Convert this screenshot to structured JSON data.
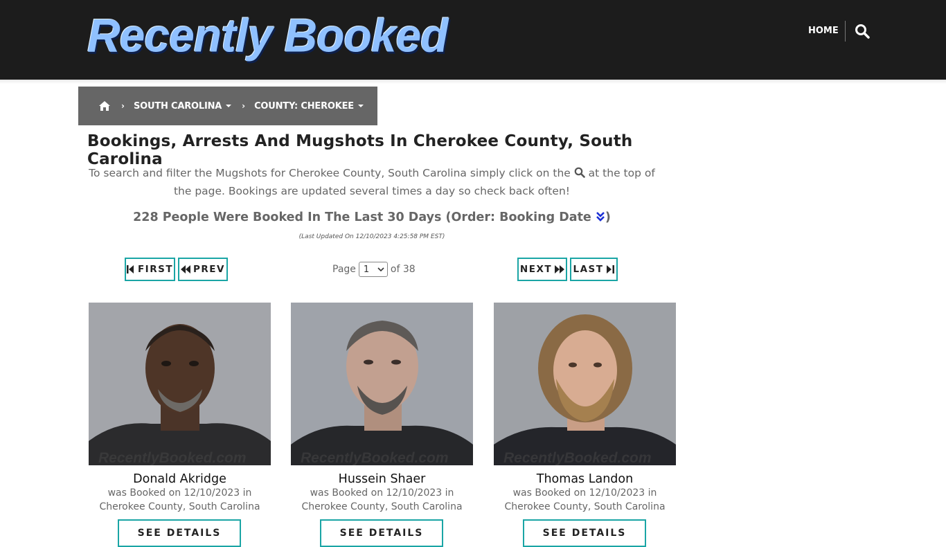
{
  "header": {
    "logo_text": "Recently Booked",
    "nav_home": "HOME",
    "search_icon": "search-icon"
  },
  "breadcrumb": {
    "home_icon": "home-icon",
    "items": [
      {
        "label": "SOUTH CAROLINA"
      },
      {
        "label": "COUNTY: CHEROKEE"
      }
    ]
  },
  "main": {
    "title": "Bookings, Arrests And Mugshots In Cherokee County, South Carolina",
    "intro_before": "To search and filter the Mugshots for Cherokee County, South Carolina simply click on the ",
    "intro_after": " at the top of the page. Bookings are updated several times a day so check back often!",
    "count_text": "228 People Were Booked In The Last 30 Days (Order: Booking Date ",
    "count_close": ")",
    "last_updated": "(Last Updated On 12/10/2023 4:25:58 PM EST)"
  },
  "pager": {
    "first": "FIRST",
    "prev": "PREV",
    "next": "NEXT",
    "last": "LAST",
    "page_label": "Page",
    "current_page": "1",
    "of_label": "of 38"
  },
  "colors": {
    "header_bg": "#1c1c1c",
    "breadcrumb_bg": "#666666",
    "accent_teal": "#1aa5a5",
    "order_icon": "#1a2fd6"
  },
  "cards": [
    {
      "name": "Donald Akridge",
      "line1": "was Booked on 12/10/2023 in",
      "line2": "Cherokee County, South Carolina",
      "button": "SEE DETAILS",
      "watermark": "RecentlyBooked.com"
    },
    {
      "name": "Hussein Shaer",
      "line1": "was Booked on 12/10/2023 in",
      "line2": "Cherokee County, South Carolina",
      "button": "SEE DETAILS",
      "watermark": "RecentlyBooked.com"
    },
    {
      "name": "Thomas Landon",
      "line1": "was Booked on 12/10/2023 in",
      "line2": "Cherokee County, South Carolina",
      "button": "SEE DETAILS",
      "watermark": "RecentlyBooked.com"
    }
  ]
}
